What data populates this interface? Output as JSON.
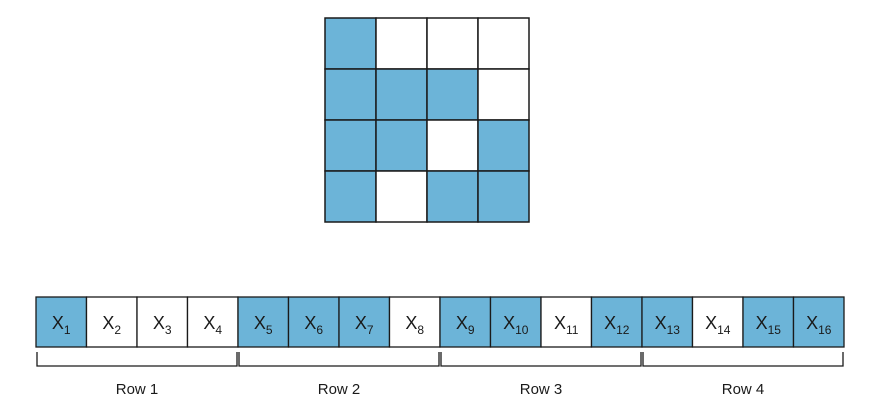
{
  "colors": {
    "filled": "#6cb4d8",
    "empty": "#ffffff",
    "stroke": "#1a1a1a"
  },
  "grid": {
    "rows": [
      [
        1,
        0,
        0,
        0
      ],
      [
        1,
        1,
        1,
        0
      ],
      [
        1,
        1,
        0,
        1
      ],
      [
        1,
        0,
        1,
        1
      ]
    ]
  },
  "vector": {
    "cells": [
      {
        "label": "X",
        "sub": "1",
        "filled": true
      },
      {
        "label": "X",
        "sub": "2",
        "filled": false
      },
      {
        "label": "X",
        "sub": "3",
        "filled": false
      },
      {
        "label": "X",
        "sub": "4",
        "filled": false
      },
      {
        "label": "X",
        "sub": "5",
        "filled": true
      },
      {
        "label": "X",
        "sub": "6",
        "filled": true
      },
      {
        "label": "X",
        "sub": "7",
        "filled": true
      },
      {
        "label": "X",
        "sub": "8",
        "filled": false
      },
      {
        "label": "X",
        "sub": "9",
        "filled": true
      },
      {
        "label": "X",
        "sub": "10",
        "filled": true
      },
      {
        "label": "X",
        "sub": "11",
        "filled": false
      },
      {
        "label": "X",
        "sub": "12",
        "filled": true
      },
      {
        "label": "X",
        "sub": "13",
        "filled": true
      },
      {
        "label": "X",
        "sub": "14",
        "filled": false
      },
      {
        "label": "X",
        "sub": "15",
        "filled": true
      },
      {
        "label": "X",
        "sub": "16",
        "filled": true
      }
    ],
    "groups": [
      "Row 1",
      "Row 2",
      "Row 3",
      "Row 4"
    ]
  }
}
